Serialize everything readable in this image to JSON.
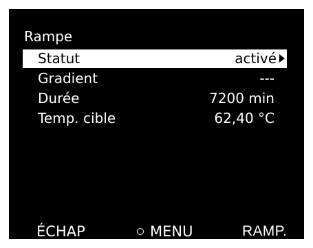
{
  "menu": {
    "title": "Rampe",
    "rows": [
      {
        "label": "Statut",
        "value": "activé",
        "selected": true,
        "has_submenu": true
      },
      {
        "label": "Gradient",
        "value": "---",
        "selected": false
      },
      {
        "label": "Durée",
        "value": "7200 min",
        "selected": false
      },
      {
        "label": "Temp. cible",
        "value": "62,40 °C",
        "selected": false
      }
    ]
  },
  "softkeys": {
    "left": "ÉCHAP",
    "center": "MENU",
    "right": "RAMP."
  },
  "colors": {
    "screen_background": "#000000",
    "text": "#ffffff",
    "highlight": "#ffffff",
    "highlight_text": "#000000"
  },
  "icons": {
    "submenu": "triangle-right-icon",
    "menu": "ring-icon"
  }
}
